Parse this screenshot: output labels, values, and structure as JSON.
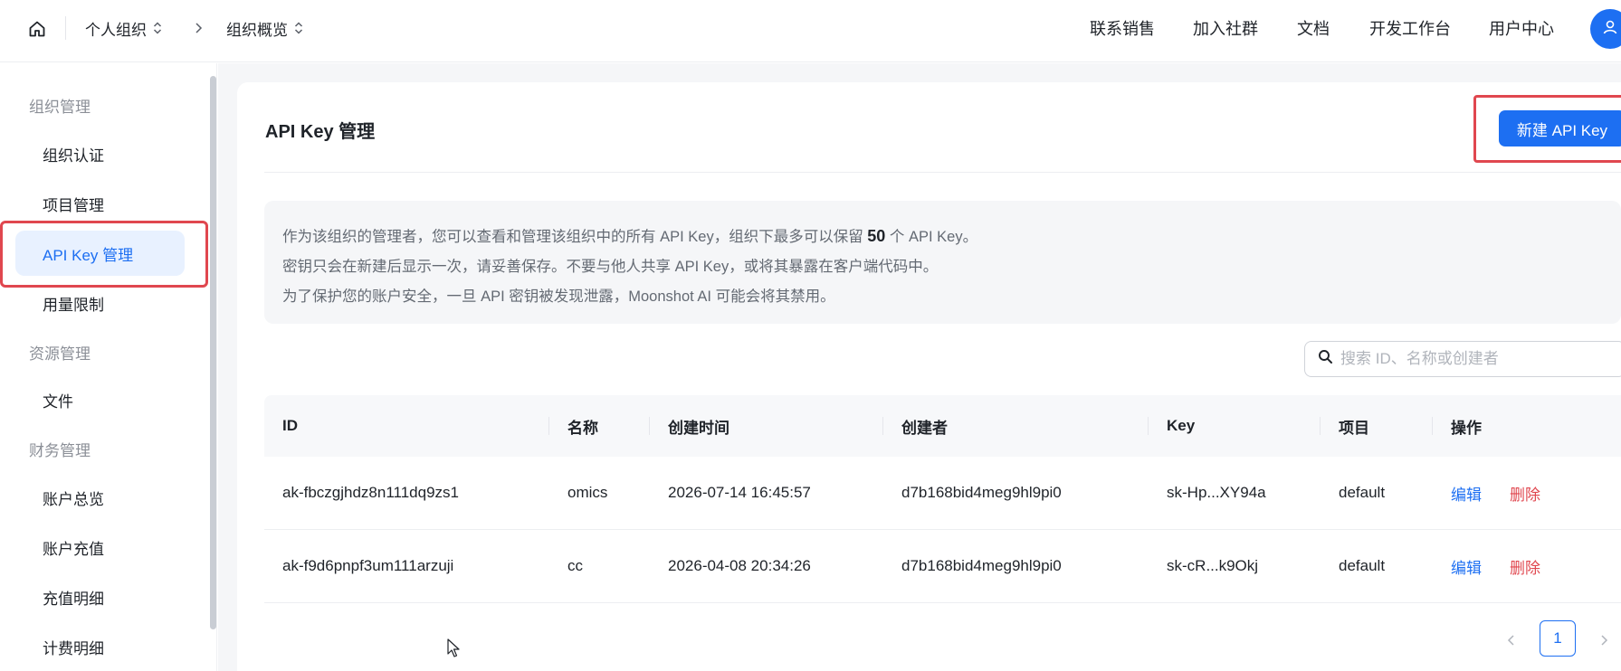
{
  "header": {
    "breadcrumb": [
      "个人组织",
      "组织概览"
    ],
    "nav_links": [
      "联系销售",
      "加入社群",
      "文档",
      "开发工作台",
      "用户中心"
    ]
  },
  "sidebar": {
    "groups": [
      {
        "title": "组织管理",
        "items": [
          "组织认证",
          "项目管理",
          "API Key 管理",
          "用量限制"
        ]
      },
      {
        "title": "资源管理",
        "items": [
          "文件"
        ]
      },
      {
        "title": "财务管理",
        "items": [
          "账户总览",
          "账户充值",
          "充值明细",
          "计费明细"
        ]
      }
    ],
    "active_item": "API Key 管理"
  },
  "main": {
    "title": "API Key 管理",
    "new_key_button": "新建 API Key",
    "notice": {
      "line1_before": "作为该组织的管理者，您可以查看和管理该组织中的所有 API Key，组织下最多可以保留 ",
      "line1_count": "50",
      "line1_after": " 个 API Key。",
      "line2": "密钥只会在新建后显示一次，请妥善保存。不要与他人共享 API Key，或将其暴露在客户端代码中。",
      "line3": "为了保护您的账户安全，一旦 API 密钥被发现泄露，Moonshot AI 可能会将其禁用。"
    },
    "search": {
      "placeholder": "搜索 ID、名称或创建者",
      "value": ""
    },
    "table": {
      "columns": [
        "ID",
        "名称",
        "创建时间",
        "创建者",
        "Key",
        "项目",
        "操作"
      ],
      "rows": [
        {
          "id": "ak-fbczgjhdz8n111dq9zs1",
          "name": "omics",
          "created_at": "2026-07-14 16:45:57",
          "creator": "d7b168bid4meg9hl9pi0",
          "key": "sk-Hp...XY94a",
          "project": "default",
          "edit": "编辑",
          "delete": "删除"
        },
        {
          "id": "ak-f9d6pnpf3um111arzuji",
          "name": "cc",
          "created_at": "2026-04-08 20:34:26",
          "creator": "d7b168bid4meg9hl9pi0",
          "key": "sk-cR...k9Okj",
          "project": "default",
          "edit": "编辑",
          "delete": "删除"
        }
      ]
    },
    "pagination": {
      "current_page": "1"
    }
  },
  "colors": {
    "accent": "#1d6ff2",
    "danger": "#e0474f",
    "highlight_box": "#e0474f"
  },
  "icons": {
    "home": "home-icon",
    "updown": "chevron-updown-icon",
    "separator": "chevron-right-icon",
    "avatar": "user-icon",
    "search": "search-icon"
  }
}
